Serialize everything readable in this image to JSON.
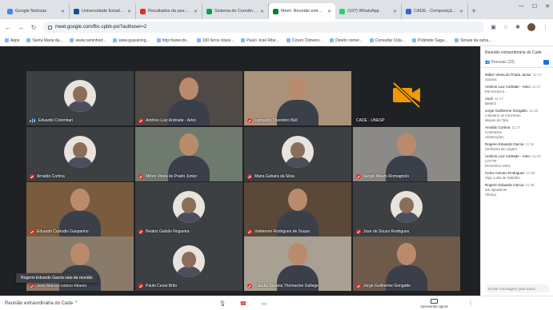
{
  "browser": {
    "tabs": [
      {
        "title": "Google Notícias",
        "color": "#4285f4"
      },
      {
        "title": "Universidade Estadual Pa...",
        "color": "#1a4d8f"
      },
      {
        "title": "Resultados da pesquisa ...",
        "color": "#d93025"
      },
      {
        "title": "Sistema de Convênio - ...",
        "color": "#0f9d58"
      },
      {
        "title": "Meet- Reunião extrao...",
        "color": "#00832d",
        "active": true
      },
      {
        "title": "(197) WhatsApp",
        "color": "#25d366"
      },
      {
        "title": "CADE - Composição - Se...",
        "color": "#3367d6"
      }
    ],
    "new_tab": "+",
    "url": "meet.google.com/fbc-cpbb-pst?authuser=2",
    "bookmarks": [
      "Apps",
      "Santa Maria da...",
      "www.caminhod...",
      "www.guaraning...",
      "http://www.do...",
      "100 livros clássi...",
      "Paulo José Ribe...",
      "Cicero Climeno...",
      "Direito comer...",
      "Consultar Cida...",
      "Pirâmide Saga...",
      "Simule da outra..."
    ]
  },
  "meet": {
    "participants": [
      {
        "name": "Eduardo Colombari",
        "status": "speaking",
        "kind": "avatar"
      },
      {
        "name": "Antônio Luiz Andrade - Advo",
        "status": "muted",
        "kind": "camera",
        "bg": "#4f4a45"
      },
      {
        "name": "Leonardo Theodoro Büll",
        "status": "muted",
        "kind": "camera",
        "bg": "#a9917a"
      },
      {
        "name": "CADE - UNESP",
        "status": "none",
        "kind": "cam-off"
      },
      {
        "name": "Arnaldo Cortina",
        "status": "muted",
        "kind": "avatar"
      },
      {
        "name": "Milton Vieira do Prado Junior",
        "status": "muted",
        "kind": "camera",
        "bg": "#6f7a6e"
      },
      {
        "name": "Maira Gebara da Silva",
        "status": "muted",
        "kind": "avatar"
      },
      {
        "name": "Sergio Mauro Romagnolo",
        "status": "muted",
        "kind": "camera",
        "bg": "#8c8a86"
      },
      {
        "name": "Eduardo Custodio Gasparino",
        "status": "muted",
        "kind": "camera",
        "bg": "#7a5b3d"
      },
      {
        "name": "Beatriz Galvão Nogueira",
        "status": "muted",
        "kind": "avatar"
      },
      {
        "name": "Valdemiro Rodrigues de Souza",
        "status": "muted",
        "kind": "camera",
        "bg": "#5a4838"
      },
      {
        "name": "Jose de Souza Rodrigues",
        "status": "muted",
        "kind": "avatar"
      },
      {
        "name": "Jean Marcos Isidoro Ribeiro",
        "status": "muted",
        "kind": "camera",
        "bg": "#8a7a6a"
      },
      {
        "name": "Paulo Cesar Brito",
        "status": "muted",
        "kind": "avatar"
      },
      {
        "name": "Claudia Suzana Thomazine Gallego",
        "status": "muted",
        "kind": "camera",
        "bg": "#a8a092"
      },
      {
        "name": "Jorge Guilherme Gongatto",
        "status": "muted",
        "kind": "camera",
        "bg": "#6e5a4a"
      }
    ],
    "toast": "Rogerio Eduardo Garcia saiu da reunião"
  },
  "panel": {
    "title": "Reunião extraordinária do Cade",
    "people_label": "Pessoas (22)",
    "messages": [
      {
        "sender": "Milton Vieira do Prado Junior",
        "time": "11:17",
        "text": "Jaraiva"
      },
      {
        "sender": "Antônio Luiz Andrade - Advo",
        "time": "11:17",
        "text": "Me incrasco..."
      },
      {
        "sender": "Você",
        "time": "11:17",
        "text": "Beatriz"
      },
      {
        "sender": "Jorge Guilherme Gongatto",
        "time": "11:25",
        "text": "A Beatriz se inscreveu"
      },
      {
        "sender": "",
        "time": "",
        "text": "depois do Tatú"
      },
      {
        "sender": "Arnaldo Cortina",
        "time": "11:27",
        "text": "Contrários"
      },
      {
        "sender": "",
        "time": "",
        "text": "Abstenções"
      },
      {
        "sender": "Rogerio Eduardo Garcia",
        "time": "11:32",
        "text": "Sinônima de origem"
      },
      {
        "sender": "Antônio Luiz Andrade - Advo",
        "time": "11:34",
        "text": "LOTTE"
      },
      {
        "sender": "",
        "time": "",
        "text": "Dezembro 2021"
      },
      {
        "sender": "Celso Antonio Rodrigues",
        "time": "11:35",
        "text": "Sigo a dia de trabalho"
      },
      {
        "sender": "Rogerio Eduardo Garcia",
        "time": "11:36",
        "text": "até agradecer"
      },
      {
        "sender": "",
        "time": "",
        "text": "Abraço"
      }
    ],
    "input_placeholder": "Enviar mensagem para todos"
  },
  "bottom": {
    "meeting_name": "Reunião extraordinária do Cade",
    "present_label": "Apresentar agora"
  }
}
